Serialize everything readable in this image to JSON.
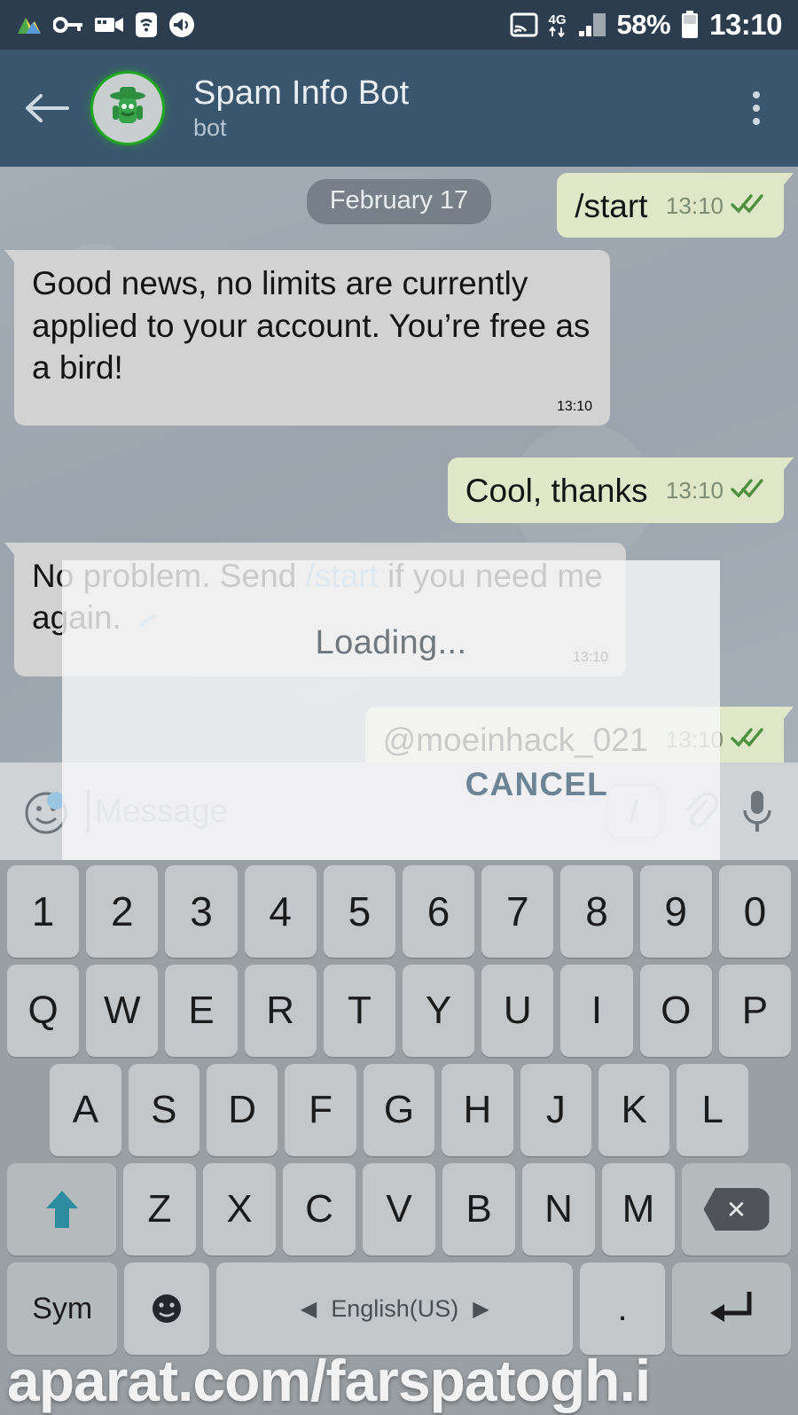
{
  "status_bar": {
    "icons_left": [
      "gallery-icon",
      "vpn-key-icon",
      "screen-record-icon",
      "wifi-icon",
      "volume-icon"
    ],
    "icons_right": [
      "cast-icon",
      "data-transfer-icon",
      "signal-icon"
    ],
    "network_label": "4G",
    "battery_percent": "58%",
    "clock": "13:10"
  },
  "header": {
    "back_label": "Back",
    "title": "Spam Info Bot",
    "subtitle": "bot",
    "avatar_alt": "bot-avatar",
    "menu_label": "More options"
  },
  "chat": {
    "date_separator": "February 17",
    "messages": [
      {
        "side": "out",
        "text": "/start",
        "time": "13:10",
        "status": "read"
      },
      {
        "side": "in",
        "text": "Good news, no limits are currently applied to your account. You’re free as a bird!",
        "time": "13:10"
      },
      {
        "side": "out",
        "text": "Cool, thanks",
        "time": "13:10",
        "status": "read"
      },
      {
        "side": "in",
        "text_before": "No problem. Send ",
        "link": "/start",
        "text_after": " if you need me again.",
        "time": "13:10"
      },
      {
        "side": "out",
        "text": "@moeinhack_021",
        "time": "13:10",
        "status": "read"
      }
    ]
  },
  "dialog": {
    "message": "Loading...",
    "cancel_label": "CANCEL"
  },
  "input_bar": {
    "placeholder": "Message",
    "emoji_icon": "emoji-smile-icon",
    "slash_label": "/",
    "attach_icon": "paperclip-icon",
    "mic_icon": "microphone-icon"
  },
  "keyboard": {
    "row_numbers": [
      "1",
      "2",
      "3",
      "4",
      "5",
      "6",
      "7",
      "8",
      "9",
      "0"
    ],
    "row_top": [
      "Q",
      "W",
      "E",
      "R",
      "T",
      "Y",
      "U",
      "I",
      "O",
      "P"
    ],
    "row_home": [
      "A",
      "S",
      "D",
      "F",
      "G",
      "H",
      "J",
      "K",
      "L"
    ],
    "row_bottom": [
      "Z",
      "X",
      "C",
      "V",
      "B",
      "N",
      "M"
    ],
    "shift_label": "shift-icon",
    "backspace_label": "backspace-icon",
    "sym_label": "Sym",
    "emoji_label": "emoji-key-icon",
    "space_label": "English(US)",
    "space_prev": "◀",
    "space_next": "▶",
    "period_label": ".",
    "enter_label": "enter-icon"
  },
  "watermark": {
    "text": "aparat.com/farspatogh.i"
  },
  "colors": {
    "status_bar_bg": "#2b3d4f",
    "header_bg": "#3a566e",
    "chat_bg": "#9fa8b0",
    "bubble_in": "#d2d2d2",
    "bubble_out": "#dfe7c7",
    "accent_link": "#7fa8cc",
    "tick_green": "#4a8f3c",
    "avatar_green": "#1fa81f",
    "cancel_blue": "#6d8496",
    "shift_teal": "#2e8ca0"
  }
}
